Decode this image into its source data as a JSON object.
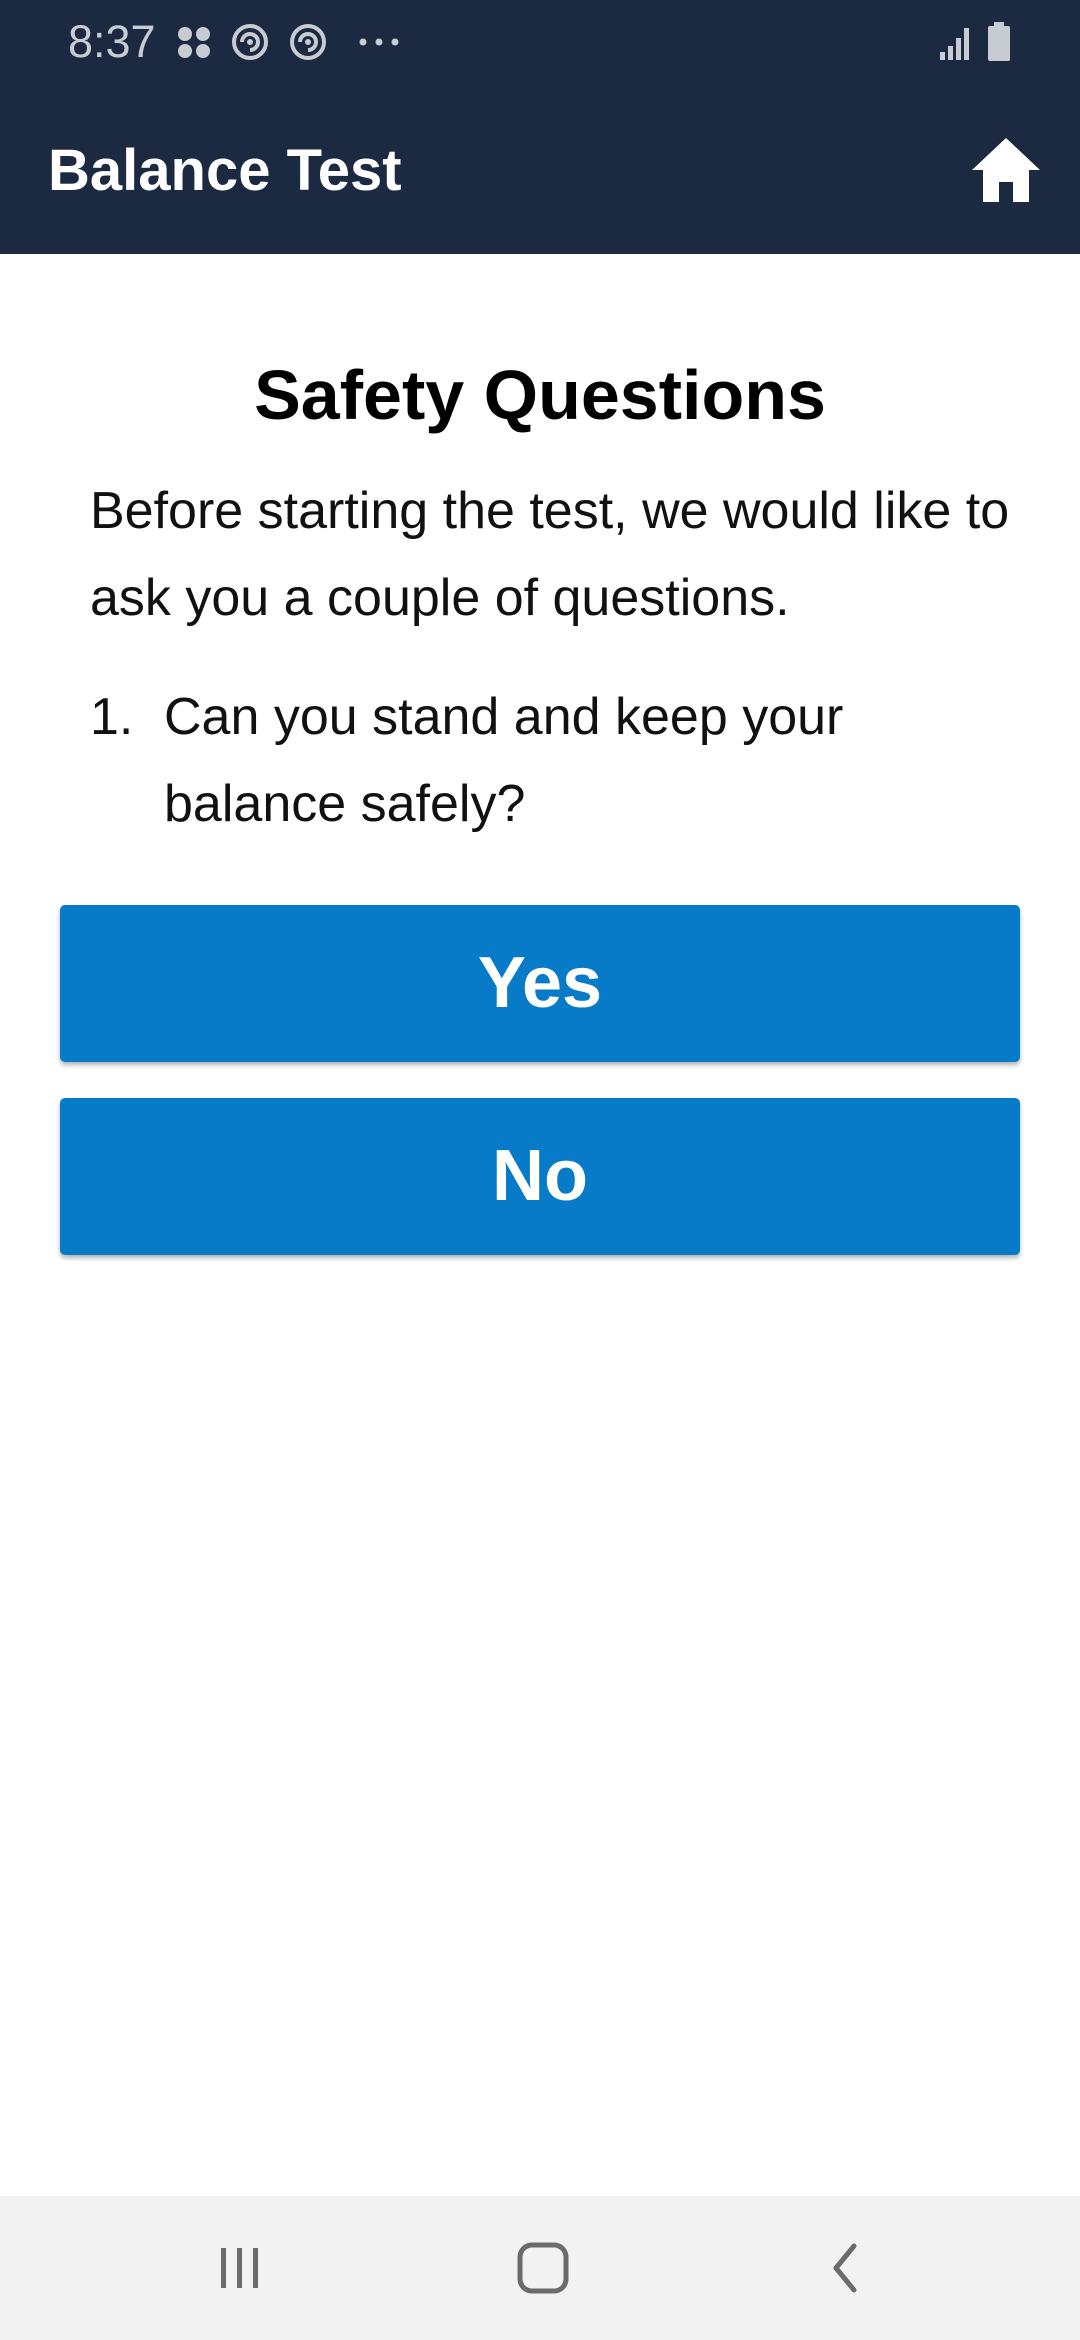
{
  "status_bar": {
    "time": "8:37",
    "icons": [
      "apps-dots-icon",
      "sync-icon",
      "sync-icon",
      "more-dots-icon",
      "signal-icon",
      "battery-icon"
    ]
  },
  "app_bar": {
    "title": "Balance Test",
    "home_icon": "home-icon"
  },
  "content": {
    "heading": "Safety Questions",
    "intro": "Before starting the test, we would like to ask you a couple of questions.",
    "question": {
      "number": "1.",
      "text": "Can you stand and keep your balance safely?"
    },
    "answers": {
      "yes": "Yes",
      "no": "No"
    }
  },
  "nav_bar": {
    "icons": [
      "recents-icon",
      "home-outline-icon",
      "back-chevron-icon"
    ]
  },
  "colors": {
    "app_bar": "#1b2a41",
    "button": "#077bc8",
    "nav_bar": "#f2f2f2"
  }
}
